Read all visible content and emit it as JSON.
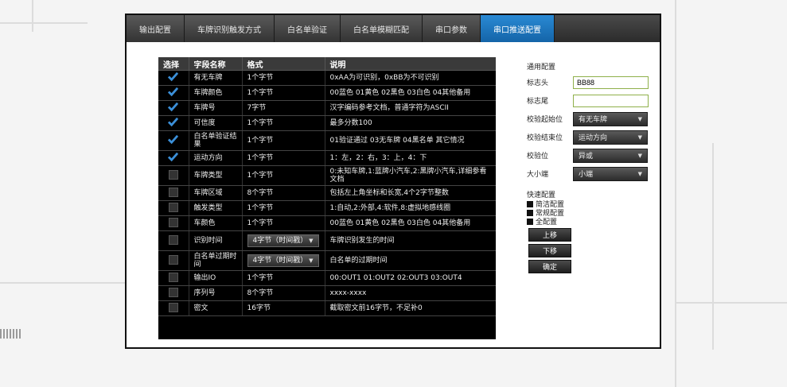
{
  "tabs": [
    {
      "label": "输出配置",
      "active": false
    },
    {
      "label": "车牌识别触发方式",
      "active": false
    },
    {
      "label": "白名单验证",
      "active": false
    },
    {
      "label": "白名单模糊匹配",
      "active": false
    },
    {
      "label": "串口参数",
      "active": false
    },
    {
      "label": "串口推送配置",
      "active": true
    }
  ],
  "table": {
    "headers": {
      "select": "选择",
      "name": "字段名称",
      "format": "格式",
      "desc": "说明"
    },
    "rows": [
      {
        "checked": true,
        "name": "有无车牌",
        "format": "1个字节",
        "desc": "0xAA为可识别，0xBB为不可识别"
      },
      {
        "checked": true,
        "name": "车牌颜色",
        "format": "1个字节",
        "desc": "00蓝色 01黄色 02黑色 03白色 04其他备用"
      },
      {
        "checked": true,
        "name": "车牌号",
        "format": "7字节",
        "desc": "汉字编码参考文档，普通字符为ASCII"
      },
      {
        "checked": true,
        "name": "可信度",
        "format": "1个字节",
        "desc": "最多分数100"
      },
      {
        "checked": true,
        "name": "白名单验证结果",
        "format": "1个字节",
        "desc": "01验证通过 03无车牌 04黑名单 其它情况"
      },
      {
        "checked": true,
        "name": "运动方向",
        "format": "1个字节",
        "desc": "1：左，2：右，3：上，4：下"
      },
      {
        "checked": false,
        "name": "车牌类型",
        "format": "1个字节",
        "desc": "0:未知车牌,1:蓝牌小汽车,2:黑牌小汽车,详细参看文档"
      },
      {
        "checked": false,
        "name": "车牌区域",
        "format": "8个字节",
        "desc": "包括左上角坐标和长宽,4个2字节整数"
      },
      {
        "checked": false,
        "name": "触发类型",
        "format": "1个字节",
        "desc": "1:自动,2:外部,4:软件,8:虚拟地感线圈"
      },
      {
        "checked": false,
        "name": "车颜色",
        "format": "1个字节",
        "desc": "00蓝色 01黄色 02黑色 03白色 04其他备用"
      },
      {
        "checked": false,
        "name": "识别时间",
        "format": "4字节（时间戳）",
        "format_dropdown": true,
        "desc": "车牌识别发生的时间"
      },
      {
        "checked": false,
        "name": "白名单过期时间",
        "format": "4字节（时间戳）",
        "format_dropdown": true,
        "desc": "白名单的过期时间"
      },
      {
        "checked": false,
        "name": "输出IO",
        "format": "1个字节",
        "desc": "00:OUT1 01:OUT2 02:OUT3 03:OUT4"
      },
      {
        "checked": false,
        "name": "序列号",
        "format": "8个字节",
        "desc": "xxxx-xxxx"
      },
      {
        "checked": false,
        "name": "密文",
        "format": "16字节",
        "desc": "截取密文前16字节，不足补0"
      }
    ]
  },
  "panel": {
    "title": "通用配置",
    "fields": {
      "header_label": "标志头",
      "header_value": "BB88",
      "tail_label": "标志尾",
      "tail_value": "",
      "check_start_label": "校验起始位",
      "check_start_value": "有无车牌",
      "check_end_label": "校验结束位",
      "check_end_value": "运动方向",
      "check_bit_label": "校验位",
      "check_bit_value": "异或",
      "endian_label": "大小端",
      "endian_value": "小端"
    },
    "quick_title": "快速配置",
    "quick_items": [
      "简洁配置",
      "常规配置",
      "全配置"
    ],
    "buttons": {
      "up": "上移",
      "down": "下移",
      "ok": "确定"
    }
  },
  "colors": {
    "accent": "#1a78c2",
    "check": "#3b8fd8"
  }
}
